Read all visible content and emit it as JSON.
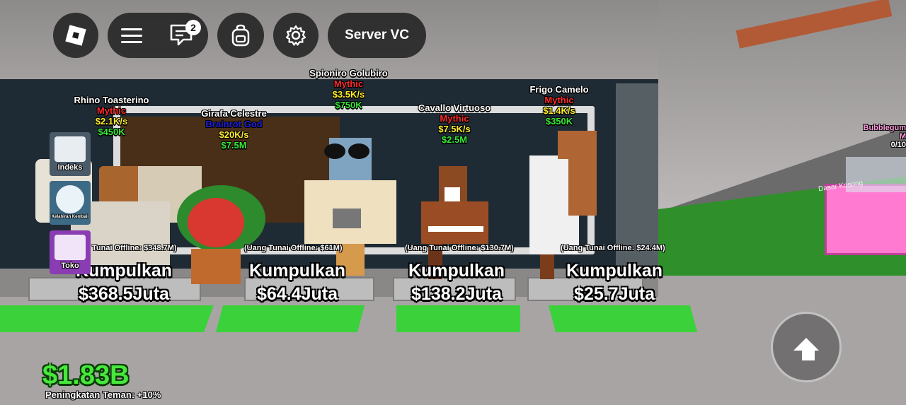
{
  "toolbar": {
    "notification_count": "2",
    "server_vc_label": "Server VC"
  },
  "pets": [
    {
      "name": "Rhino Toasterino",
      "rarity": "Mythic",
      "rate": "$2.1K/s",
      "price": "$450K"
    },
    {
      "name": "Girafa Celestre",
      "rarity": "Brainrot God",
      "rate": "$20K/s",
      "price": "$7.5M"
    },
    {
      "name": "Spioniro Golubiro",
      "rarity": "Mythic",
      "rate": "$3.5K/s",
      "price": "$750K"
    },
    {
      "name": "Cavallo Virtuoso",
      "rarity": "Mythic",
      "rate": "$7.5K/s",
      "price": "$2.5M"
    },
    {
      "name": "Frigo Camelo",
      "rarity": "Mythic",
      "rate": "$1.4K/s",
      "price": "$350K"
    }
  ],
  "collect_stations": [
    {
      "offline": "Tunai Offline: $348.7M)",
      "label": "Kumpulkan",
      "amount": "$368.5Juta"
    },
    {
      "offline": "(Uang Tunai Offline: $61M)",
      "label": "Kumpulkan",
      "amount": "$64.4Juta"
    },
    {
      "offline": "(Uang Tunai Offline: $130.7M)",
      "label": "Kumpulkan",
      "amount": "$138.2Juta"
    },
    {
      "offline": "(Uang Tunai Offline: $24.4M)",
      "label": "Kumpulkan",
      "amount": "$25.7Juta"
    }
  ],
  "side_menu": {
    "index_label": "Indeks",
    "rebirth_label": "Kelahiran Kembali",
    "shop_label": "Toko"
  },
  "remote_label": {
    "name": "Bubblegum M",
    "count": "0/10"
  },
  "sign_text": "Dasar Kosong",
  "hud": {
    "money": "$1.83B",
    "friend_boost": "Peningkatan Teman: +10%"
  },
  "colors": {
    "mythic": "#ff2a2a",
    "brainrot_god": "#2020d8",
    "rate": "#ffee2a",
    "price": "#39e83a",
    "money": "#47e83c"
  }
}
